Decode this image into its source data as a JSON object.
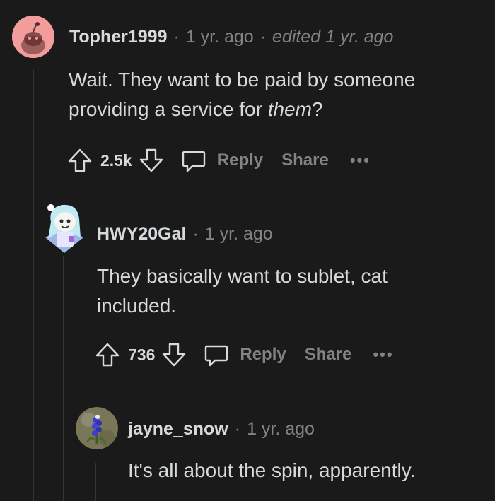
{
  "colors": {
    "background": "#1a1a1b",
    "text": "#d7dadc",
    "muted": "#818384",
    "thread_line": "#343536",
    "avatar_pink": "#f29c9c"
  },
  "comments": [
    {
      "username": "Topher1999",
      "separator": "·",
      "time": "1 yr. ago",
      "edited": "edited 1 yr. ago",
      "body_line1": "Wait. They want to be paid by someone",
      "body_line2_prefix": "providing a service for ",
      "body_line2_em": "them",
      "body_line2_suffix": "?",
      "score": "2.5k",
      "reply_label": "Reply",
      "share_label": "Share",
      "more_label": "•••",
      "avatar_icon": "default-snoo-avatar-icon"
    },
    {
      "username": "HWY20Gal",
      "separator": "·",
      "time": "1 yr. ago",
      "body_line1": "They basically want to sublet, cat",
      "body_line2": "included.",
      "score": "736",
      "reply_label": "Reply",
      "share_label": "Share",
      "more_label": "•••",
      "avatar_icon": "custom-snoo-avatar-icon"
    },
    {
      "username": "jayne_snow",
      "separator": "·",
      "time": "1 yr. ago",
      "body_line1": "It's all about the spin, apparently.",
      "avatar_icon": "bluebonnet-photo-avatar"
    }
  ]
}
